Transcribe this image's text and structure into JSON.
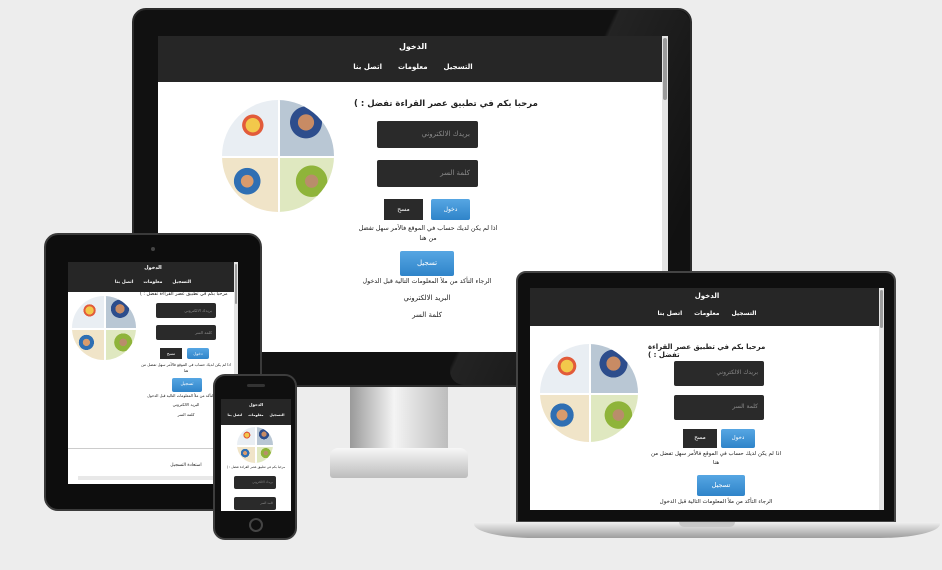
{
  "site": {
    "brand": "الدخول",
    "menu": [
      "التسجيل",
      "معلومات",
      "اتصل بنا"
    ],
    "welcome": "مرحبا بكم في تطبيق عصر القراءة تفضل : )",
    "email_placeholder": "بريدك الالكتروني",
    "password_placeholder": "كلمة السر",
    "login_label": "دخول",
    "clear_label": "مسح",
    "no_account_text": "اذا لم يكن لديك حساب في الموقع فالأمر سهل تفضل من هنا",
    "register_label": "تسجيل",
    "check_info_text": "الرجاء التأكد من ملأ المعلومات التالية قبل الدخول",
    "email_label": "البريد الالكتروني",
    "password_label": "كلمة السر"
  },
  "tablet": {
    "recovery_label": "استعادة التسجيل"
  },
  "colors": {
    "navbar": "#262626",
    "field": "#2a2a2a",
    "primary_button": "#3a90d3",
    "background": "#ededed"
  }
}
